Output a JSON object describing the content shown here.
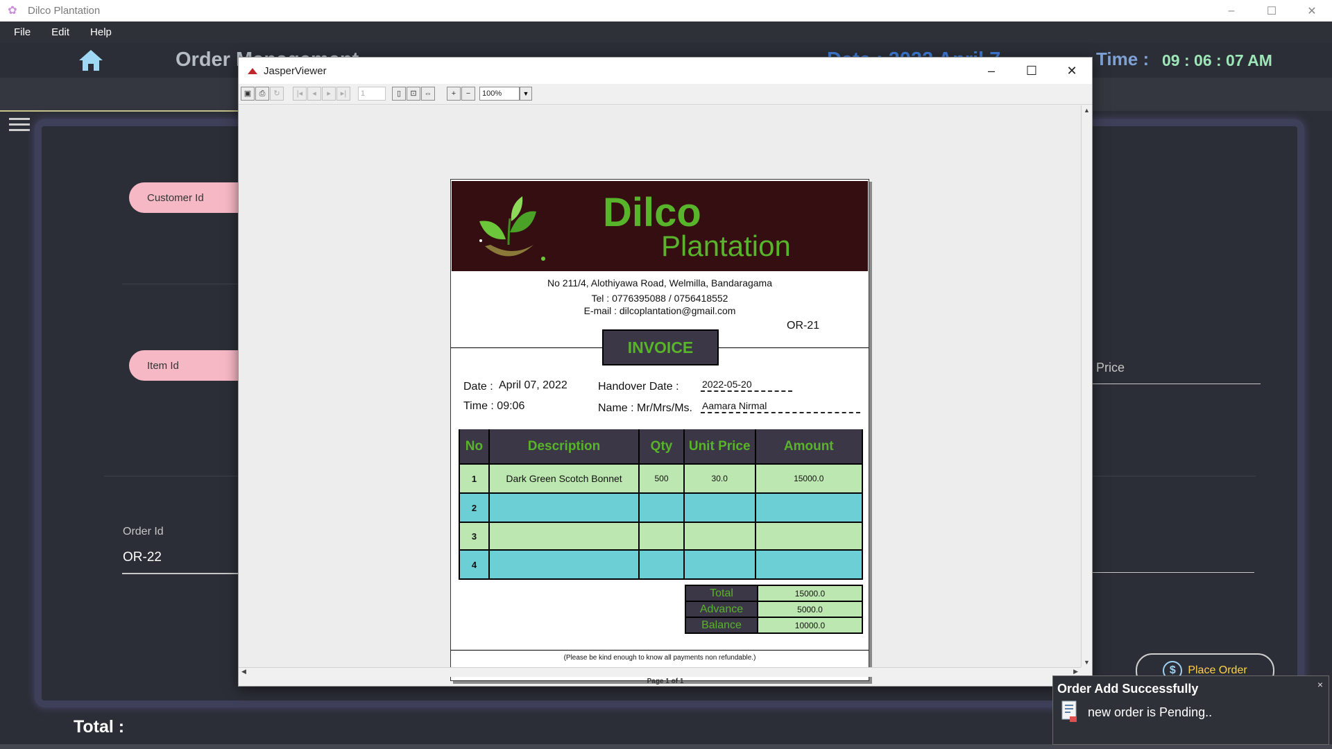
{
  "app": {
    "title": "Dilco Plantation",
    "menu": [
      "File",
      "Edit",
      "Help"
    ],
    "heading": "Order Management",
    "date_label": "Date :  2022 April 7",
    "time_label": "Time :",
    "time_value": "09 : 06 : 07 AM",
    "customer_id_label": "Customer Id",
    "item_id_label": "Item Id",
    "price_label": "Price",
    "order_id_label": "Order Id",
    "order_id_value": "OR-22",
    "place_order_label": "Place Order",
    "total_label": "Total  :"
  },
  "viewer": {
    "title": "JasperViewer",
    "page_input": "1",
    "zoom": "100%",
    "status": "Page 1 of 1"
  },
  "invoice": {
    "brand_line1": "Dilco",
    "brand_line2": "Plantation",
    "address": "No 211/4, Alothiyawa Road, Welmilla, Bandaragama",
    "tel": "Tel : 0776395088 / 0756418552",
    "email": "E-mail : dilcoplantation@gmail.com",
    "order_no": "OR-21",
    "heading": "INVOICE",
    "date_label": "Date :",
    "date_value": "April 07, 2022",
    "time_label": "Time : 09:06",
    "handover_label": "Handover Date :",
    "handover_value": "2022-05-20",
    "name_label": "Name : Mr/Mrs/Ms.",
    "name_value": "Aamara Nirmal",
    "columns": [
      "No",
      "Description",
      "Qty",
      "Unit Price",
      "Amount"
    ],
    "rows": [
      {
        "no": "1",
        "description": "Dark Green Scotch Bonnet",
        "qty": "500",
        "unit_price": "30.0",
        "amount": "15000.0"
      },
      {
        "no": "2",
        "description": "",
        "qty": "",
        "unit_price": "",
        "amount": ""
      },
      {
        "no": "3",
        "description": "",
        "qty": "",
        "unit_price": "",
        "amount": ""
      },
      {
        "no": "4",
        "description": "",
        "qty": "",
        "unit_price": "",
        "amount": ""
      }
    ],
    "total_label": "Total",
    "total_value": "15000.0",
    "advance_label": "Advance",
    "advance_value": "5000.0",
    "balance_label": "Balance",
    "balance_value": "10000.0",
    "footnote": "(Please be kind enough to know all payments non refundable.)"
  },
  "notification": {
    "title": "Order Add Successfully",
    "message": "new order is Pending..",
    "close": "×"
  },
  "colors": {
    "banner": "#340e10",
    "brand_green": "#58b42a",
    "header_dark": "#3b3746",
    "row_green": "#bde7b0",
    "row_cyan": "#6dcfd6",
    "pill_pink": "#f7b8c6"
  }
}
